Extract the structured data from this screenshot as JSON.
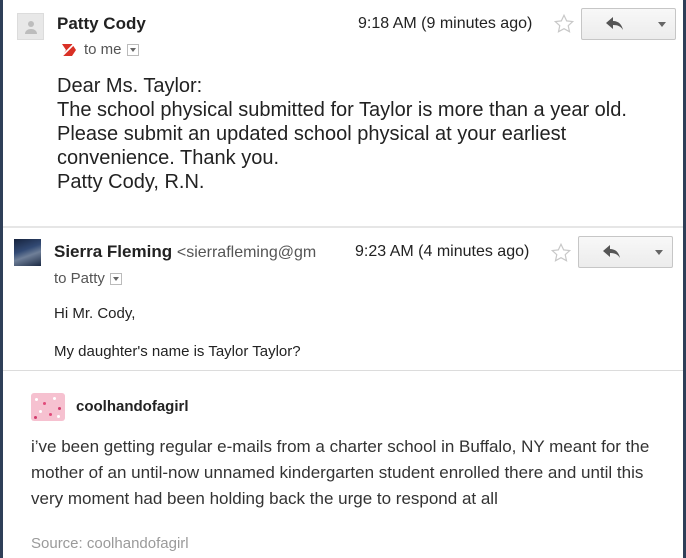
{
  "email1": {
    "sender": "Patty Cody",
    "time": "9:18 AM (9 minutes ago)",
    "recipient": "to me",
    "body": [
      "Dear Ms. Taylor:",
      "The school physical submitted for Taylor is more than a year old. Please submit an updated school physical at your earliest convenience. Thank you.",
      "Patty Cody, R.N."
    ]
  },
  "email2": {
    "sender": "Sierra Fleming",
    "sender_email": "<sierrafleming@gm",
    "time": "9:23 AM (4 minutes ago)",
    "recipient": "to Patty",
    "body": [
      "Hi Mr. Cody,",
      "My daughter's name is Taylor Taylor?"
    ]
  },
  "post": {
    "username": "coolhandofagirl",
    "text": "i’ve been getting regular e-mails from a charter school in Buffalo, NY meant for the mother of an until-now unnamed kindergarten student enrolled there and until this very moment had been holding back the urge to respond at all",
    "source": "Source: coolhandofagirl"
  },
  "colors": {
    "border": "#2f3f58",
    "important_marker": "#d93025"
  },
  "icons": [
    "person-icon",
    "star-icon",
    "reply-icon",
    "chevron-down-icon",
    "important-marker-icon"
  ]
}
